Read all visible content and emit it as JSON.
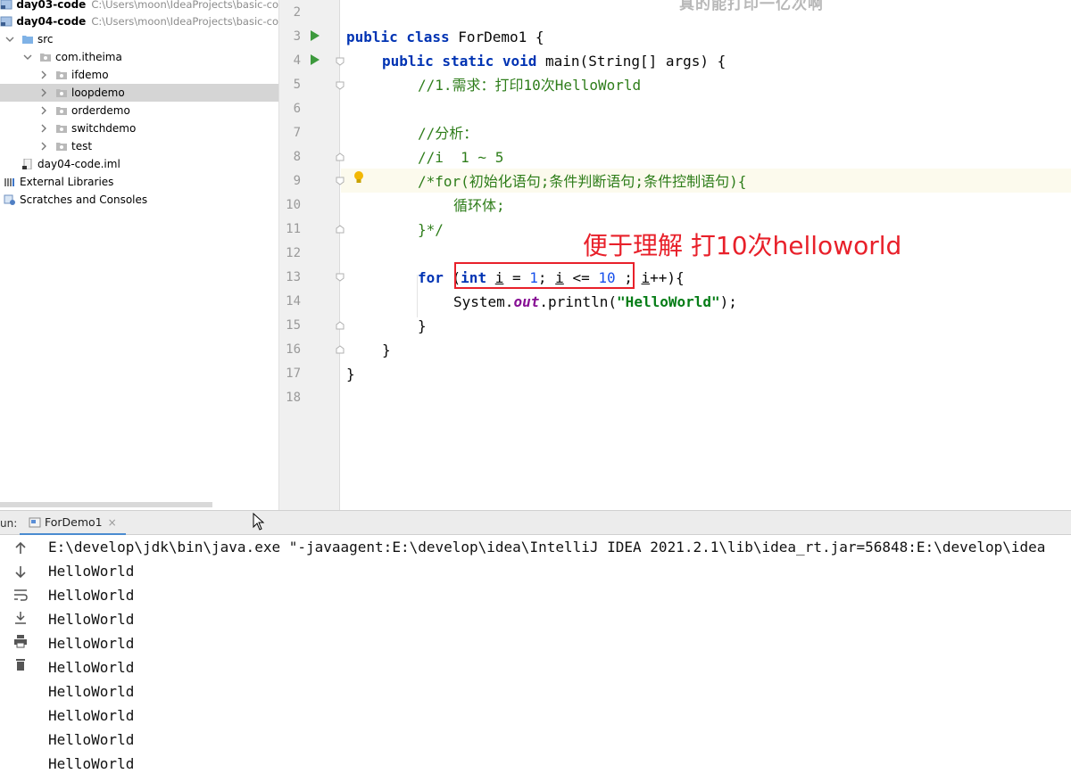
{
  "project_tree": {
    "items": [
      {
        "label": "day03-code",
        "path": "C:\\Users\\moon\\IdeaProjects\\basic-co",
        "kind": "module",
        "depth": 0
      },
      {
        "label": "day04-code",
        "path": "C:\\Users\\moon\\IdeaProjects\\basic-co",
        "kind": "module",
        "depth": 0
      },
      {
        "label": "src",
        "kind": "folder-src",
        "depth": 1,
        "expanded": true
      },
      {
        "label": "com.itheima",
        "kind": "package",
        "depth": 2,
        "expanded": true
      },
      {
        "label": "ifdemo",
        "kind": "package",
        "depth": 3
      },
      {
        "label": "loopdemo",
        "kind": "package",
        "depth": 3,
        "selected": true
      },
      {
        "label": "orderdemo",
        "kind": "package",
        "depth": 3
      },
      {
        "label": "switchdemo",
        "kind": "package",
        "depth": 3
      },
      {
        "label": "test",
        "kind": "package",
        "depth": 3
      },
      {
        "label": "day04-code.iml",
        "kind": "iml-file",
        "depth": 1
      },
      {
        "label": "External Libraries",
        "kind": "libraries",
        "depth": 0
      },
      {
        "label": "Scratches and Consoles",
        "kind": "scratches",
        "depth": 0
      }
    ]
  },
  "editor": {
    "overlay_title": "真的能打印一亿次啊",
    "line_numbers": [
      "2",
      "3",
      "4",
      "5",
      "6",
      "7",
      "8",
      "9",
      "10",
      "11",
      "12",
      "13",
      "14",
      "15",
      "16",
      "17",
      "18"
    ],
    "current_line": "9",
    "code": {
      "l3_kw": "public class",
      "l3_rest": " ForDemo1 {",
      "l4_kw": "public static void",
      "l4_rest": " main(String[] args) {",
      "l5": "//1.需求：打印10次HelloWorld",
      "l7": "//分析：",
      "l8": "//i  1 ~ 5",
      "l9": "/*for(初始化语句;条件判断语句;条件控制语句){",
      "l10": "循环体;",
      "l11": "}*/",
      "l13_kw1": "for",
      "l13_p1": " (",
      "l13_kw2": "int",
      "l13_sp": " ",
      "l13_i1": "i",
      "l13_eq": " = ",
      "l13_n1": "1",
      "l13_semi": "; ",
      "l13_i2": "i",
      "l13_le": " <= ",
      "l13_n2": "10",
      "l13_rest1": " ; ",
      "l13_i3": "i",
      "l13_rest2": "++){",
      "l14_a": "System.",
      "l14_out": "out",
      "l14_b": ".println(",
      "l14_str": "\"HelloWorld\"",
      "l14_c": ");",
      "l15": "}",
      "l16": "}",
      "l17": "}"
    },
    "annotation": "便于理解 打10次helloworld"
  },
  "run_panel": {
    "label": "un:",
    "tab_label": "ForDemo1",
    "tab_close": "×",
    "console_lines": [
      "E:\\develop\\jdk\\bin\\java.exe \"-javaagent:E:\\develop\\idea\\IntelliJ IDEA 2021.2.1\\lib\\idea_rt.jar=56848:E:\\develop\\idea",
      "HelloWorld",
      "HelloWorld",
      "HelloWorld",
      "HelloWorld",
      "HelloWorld",
      "HelloWorld",
      "HelloWorld",
      "HelloWorld",
      "HelloWorld"
    ]
  },
  "colors": {
    "keyword": "#0033b3",
    "comment": "#2e7d1a",
    "number": "#1750eb",
    "string": "#067d17",
    "annotation": "#e8202a",
    "selection": "#d5d5d5"
  }
}
